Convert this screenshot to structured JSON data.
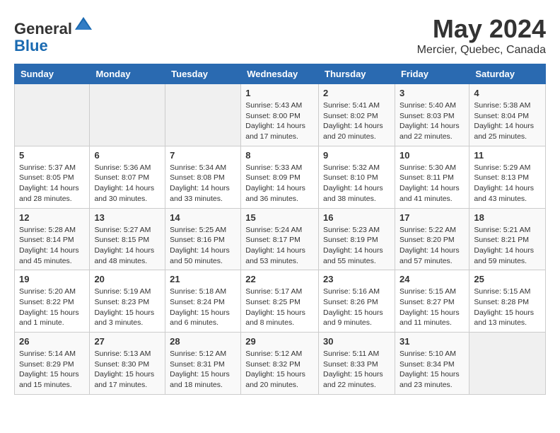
{
  "header": {
    "logo_general": "General",
    "logo_blue": "Blue",
    "month_year": "May 2024",
    "location": "Mercier, Quebec, Canada"
  },
  "days_of_week": [
    "Sunday",
    "Monday",
    "Tuesday",
    "Wednesday",
    "Thursday",
    "Friday",
    "Saturday"
  ],
  "weeks": [
    [
      {
        "day": "",
        "info": ""
      },
      {
        "day": "",
        "info": ""
      },
      {
        "day": "",
        "info": ""
      },
      {
        "day": "1",
        "info": "Sunrise: 5:43 AM\nSunset: 8:00 PM\nDaylight: 14 hours\nand 17 minutes."
      },
      {
        "day": "2",
        "info": "Sunrise: 5:41 AM\nSunset: 8:02 PM\nDaylight: 14 hours\nand 20 minutes."
      },
      {
        "day": "3",
        "info": "Sunrise: 5:40 AM\nSunset: 8:03 PM\nDaylight: 14 hours\nand 22 minutes."
      },
      {
        "day": "4",
        "info": "Sunrise: 5:38 AM\nSunset: 8:04 PM\nDaylight: 14 hours\nand 25 minutes."
      }
    ],
    [
      {
        "day": "5",
        "info": "Sunrise: 5:37 AM\nSunset: 8:05 PM\nDaylight: 14 hours\nand 28 minutes."
      },
      {
        "day": "6",
        "info": "Sunrise: 5:36 AM\nSunset: 8:07 PM\nDaylight: 14 hours\nand 30 minutes."
      },
      {
        "day": "7",
        "info": "Sunrise: 5:34 AM\nSunset: 8:08 PM\nDaylight: 14 hours\nand 33 minutes."
      },
      {
        "day": "8",
        "info": "Sunrise: 5:33 AM\nSunset: 8:09 PM\nDaylight: 14 hours\nand 36 minutes."
      },
      {
        "day": "9",
        "info": "Sunrise: 5:32 AM\nSunset: 8:10 PM\nDaylight: 14 hours\nand 38 minutes."
      },
      {
        "day": "10",
        "info": "Sunrise: 5:30 AM\nSunset: 8:11 PM\nDaylight: 14 hours\nand 41 minutes."
      },
      {
        "day": "11",
        "info": "Sunrise: 5:29 AM\nSunset: 8:13 PM\nDaylight: 14 hours\nand 43 minutes."
      }
    ],
    [
      {
        "day": "12",
        "info": "Sunrise: 5:28 AM\nSunset: 8:14 PM\nDaylight: 14 hours\nand 45 minutes."
      },
      {
        "day": "13",
        "info": "Sunrise: 5:27 AM\nSunset: 8:15 PM\nDaylight: 14 hours\nand 48 minutes."
      },
      {
        "day": "14",
        "info": "Sunrise: 5:25 AM\nSunset: 8:16 PM\nDaylight: 14 hours\nand 50 minutes."
      },
      {
        "day": "15",
        "info": "Sunrise: 5:24 AM\nSunset: 8:17 PM\nDaylight: 14 hours\nand 53 minutes."
      },
      {
        "day": "16",
        "info": "Sunrise: 5:23 AM\nSunset: 8:19 PM\nDaylight: 14 hours\nand 55 minutes."
      },
      {
        "day": "17",
        "info": "Sunrise: 5:22 AM\nSunset: 8:20 PM\nDaylight: 14 hours\nand 57 minutes."
      },
      {
        "day": "18",
        "info": "Sunrise: 5:21 AM\nSunset: 8:21 PM\nDaylight: 14 hours\nand 59 minutes."
      }
    ],
    [
      {
        "day": "19",
        "info": "Sunrise: 5:20 AM\nSunset: 8:22 PM\nDaylight: 15 hours\nand 1 minute."
      },
      {
        "day": "20",
        "info": "Sunrise: 5:19 AM\nSunset: 8:23 PM\nDaylight: 15 hours\nand 3 minutes."
      },
      {
        "day": "21",
        "info": "Sunrise: 5:18 AM\nSunset: 8:24 PM\nDaylight: 15 hours\nand 6 minutes."
      },
      {
        "day": "22",
        "info": "Sunrise: 5:17 AM\nSunset: 8:25 PM\nDaylight: 15 hours\nand 8 minutes."
      },
      {
        "day": "23",
        "info": "Sunrise: 5:16 AM\nSunset: 8:26 PM\nDaylight: 15 hours\nand 9 minutes."
      },
      {
        "day": "24",
        "info": "Sunrise: 5:15 AM\nSunset: 8:27 PM\nDaylight: 15 hours\nand 11 minutes."
      },
      {
        "day": "25",
        "info": "Sunrise: 5:15 AM\nSunset: 8:28 PM\nDaylight: 15 hours\nand 13 minutes."
      }
    ],
    [
      {
        "day": "26",
        "info": "Sunrise: 5:14 AM\nSunset: 8:29 PM\nDaylight: 15 hours\nand 15 minutes."
      },
      {
        "day": "27",
        "info": "Sunrise: 5:13 AM\nSunset: 8:30 PM\nDaylight: 15 hours\nand 17 minutes."
      },
      {
        "day": "28",
        "info": "Sunrise: 5:12 AM\nSunset: 8:31 PM\nDaylight: 15 hours\nand 18 minutes."
      },
      {
        "day": "29",
        "info": "Sunrise: 5:12 AM\nSunset: 8:32 PM\nDaylight: 15 hours\nand 20 minutes."
      },
      {
        "day": "30",
        "info": "Sunrise: 5:11 AM\nSunset: 8:33 PM\nDaylight: 15 hours\nand 22 minutes."
      },
      {
        "day": "31",
        "info": "Sunrise: 5:10 AM\nSunset: 8:34 PM\nDaylight: 15 hours\nand 23 minutes."
      },
      {
        "day": "",
        "info": ""
      }
    ]
  ]
}
